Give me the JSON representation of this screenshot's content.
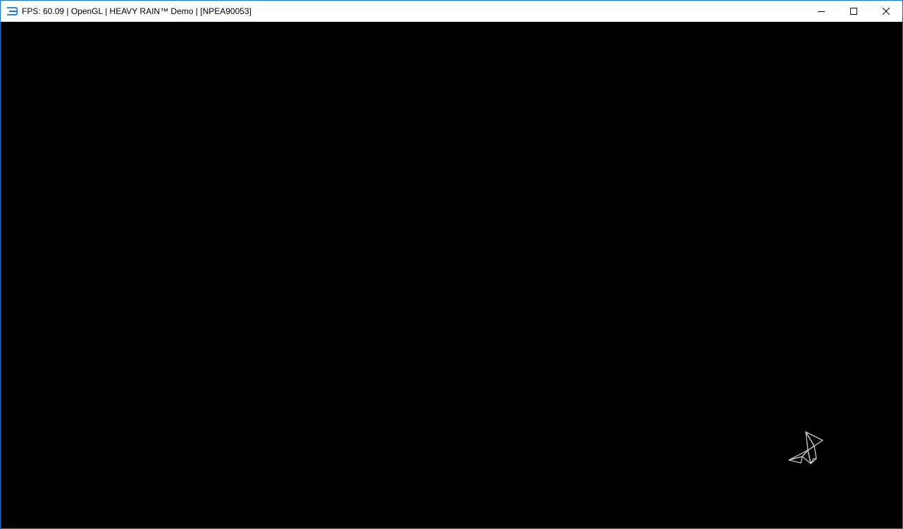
{
  "window": {
    "title": "FPS: 60.09 | OpenGL | HEAVY RAIN™ Demo | [NPEA90053]",
    "app_icon": "rpcs3-logo-icon",
    "controls": {
      "minimize": "minimize-icon",
      "maximize": "maximize-icon",
      "close": "close-icon"
    }
  },
  "viewport": {
    "background": "#000000",
    "loading_indicator": "origami-bird-icon",
    "indicator_color": "#c8c8c8"
  },
  "colors": {
    "accent": "#1a73c9",
    "titlebar_bg": "#ffffff"
  }
}
